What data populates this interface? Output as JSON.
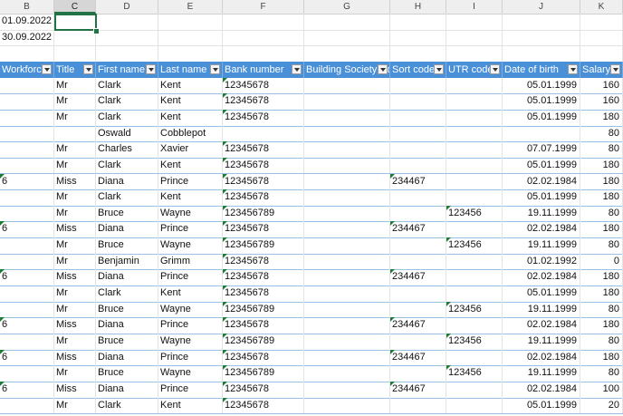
{
  "column_letters": [
    "B",
    "C",
    "D",
    "E",
    "F",
    "G",
    "H",
    "I",
    "J",
    "K"
  ],
  "selected_column": "C",
  "top_cells": [
    "01.09.2022",
    "30.09.2022"
  ],
  "headers": [
    "Workforce",
    "Title",
    "First name",
    "Last name",
    "Bank number",
    "Building Society Ro",
    "Sort code",
    "UTR code",
    "Date of birth",
    "Salary"
  ],
  "rows": [
    {
      "workforce": "",
      "title": "Mr",
      "first": "Clark",
      "last": "Kent",
      "bank": "12345678",
      "sort": "",
      "utr": "",
      "dob": "05.01.1999",
      "salary": "160"
    },
    {
      "workforce": "",
      "title": "Mr",
      "first": "Clark",
      "last": "Kent",
      "bank": "12345678",
      "sort": "",
      "utr": "",
      "dob": "05.01.1999",
      "salary": "160"
    },
    {
      "workforce": "",
      "title": "Mr",
      "first": "Clark",
      "last": "Kent",
      "bank": "12345678",
      "sort": "",
      "utr": "",
      "dob": "05.01.1999",
      "salary": "180"
    },
    {
      "workforce": "",
      "title": "",
      "first": "Oswald",
      "last": "Cobblepot",
      "bank": "",
      "sort": "",
      "utr": "",
      "dob": "",
      "salary": "80"
    },
    {
      "workforce": "",
      "title": "Mr",
      "first": "Charles",
      "last": "Xavier",
      "bank": "12345678",
      "sort": "",
      "utr": "",
      "dob": "07.07.1999",
      "salary": "80"
    },
    {
      "workforce": "",
      "title": "Mr",
      "first": "Clark",
      "last": "Kent",
      "bank": "12345678",
      "sort": "",
      "utr": "",
      "dob": "05.01.1999",
      "salary": "180"
    },
    {
      "workforce": "6",
      "title": "Miss",
      "first": "Diana",
      "last": "Prince",
      "bank": "12345678",
      "sort": "234467",
      "utr": "",
      "dob": "02.02.1984",
      "salary": "180"
    },
    {
      "workforce": "",
      "title": "Mr",
      "first": "Clark",
      "last": "Kent",
      "bank": "12345678",
      "sort": "",
      "utr": "",
      "dob": "05.01.1999",
      "salary": "180"
    },
    {
      "workforce": "",
      "title": "Mr",
      "first": "Bruce",
      "last": "Wayne",
      "bank": "123456789",
      "sort": "",
      "utr": "123456",
      "dob": "19.11.1999",
      "salary": "80"
    },
    {
      "workforce": "6",
      "title": "Miss",
      "first": "Diana",
      "last": "Prince",
      "bank": "12345678",
      "sort": "234467",
      "utr": "",
      "dob": "02.02.1984",
      "salary": "180"
    },
    {
      "workforce": "",
      "title": "Mr",
      "first": "Bruce",
      "last": "Wayne",
      "bank": "123456789",
      "sort": "",
      "utr": "123456",
      "dob": "19.11.1999",
      "salary": "80"
    },
    {
      "workforce": "",
      "title": "Mr",
      "first": "Benjamin",
      "last": "Grimm",
      "bank": "12345678",
      "sort": "",
      "utr": "",
      "dob": "01.02.1992",
      "salary": "0"
    },
    {
      "workforce": "6",
      "title": "Miss",
      "first": "Diana",
      "last": "Prince",
      "bank": "12345678",
      "sort": "234467",
      "utr": "",
      "dob": "02.02.1984",
      "salary": "180"
    },
    {
      "workforce": "",
      "title": "Mr",
      "first": "Clark",
      "last": "Kent",
      "bank": "12345678",
      "sort": "",
      "utr": "",
      "dob": "05.01.1999",
      "salary": "180"
    },
    {
      "workforce": "",
      "title": "Mr",
      "first": "Bruce",
      "last": "Wayne",
      "bank": "123456789",
      "sort": "",
      "utr": "123456",
      "dob": "19.11.1999",
      "salary": "80"
    },
    {
      "workforce": "6",
      "title": "Miss",
      "first": "Diana",
      "last": "Prince",
      "bank": "12345678",
      "sort": "234467",
      "utr": "",
      "dob": "02.02.1984",
      "salary": "180"
    },
    {
      "workforce": "",
      "title": "Mr",
      "first": "Bruce",
      "last": "Wayne",
      "bank": "123456789",
      "sort": "",
      "utr": "123456",
      "dob": "19.11.1999",
      "salary": "80"
    },
    {
      "workforce": "6",
      "title": "Miss",
      "first": "Diana",
      "last": "Prince",
      "bank": "12345678",
      "sort": "234467",
      "utr": "",
      "dob": "02.02.1984",
      "salary": "180"
    },
    {
      "workforce": "",
      "title": "Mr",
      "first": "Bruce",
      "last": "Wayne",
      "bank": "123456789",
      "sort": "",
      "utr": "123456",
      "dob": "19.11.1999",
      "salary": "80"
    },
    {
      "workforce": "6",
      "title": "Miss",
      "first": "Diana",
      "last": "Prince",
      "bank": "12345678",
      "sort": "234467",
      "utr": "",
      "dob": "02.02.1984",
      "salary": "100"
    },
    {
      "workforce": "",
      "title": "Mr",
      "first": "Clark",
      "last": "Kent",
      "bank": "12345678",
      "sort": "",
      "utr": "",
      "dob": "05.01.1999",
      "salary": "20"
    }
  ]
}
